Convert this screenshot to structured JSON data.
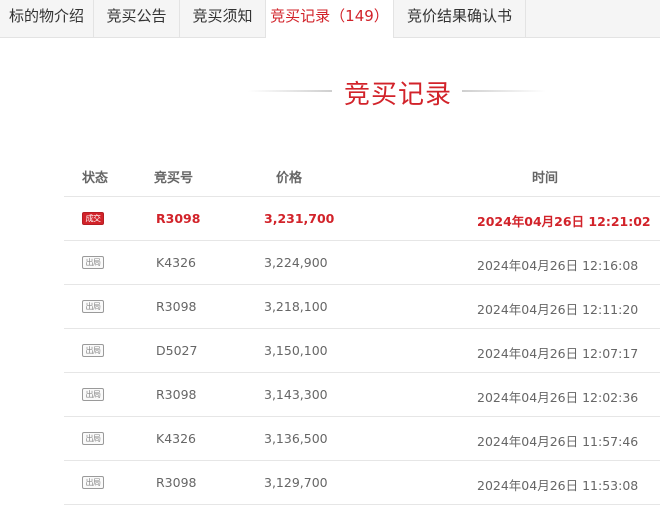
{
  "tabs": [
    {
      "label": "标的物介绍"
    },
    {
      "label": "竞买公告"
    },
    {
      "label": "竞买须知"
    },
    {
      "label": "竞买记录（149）"
    },
    {
      "label": "竞价结果确认书"
    }
  ],
  "section": {
    "title": "竞买记录"
  },
  "table": {
    "headers": {
      "status": "状态",
      "bid_no": "竞买号",
      "price": "价格",
      "time": "时间"
    },
    "rows": [
      {
        "status": "成交",
        "bid_no": "R3098",
        "price": "3,231,700",
        "time": "2024年04月26日 12:21:02"
      },
      {
        "status": "出局",
        "bid_no": "K4326",
        "price": "3,224,900",
        "time": "2024年04月26日 12:16:08"
      },
      {
        "status": "出局",
        "bid_no": "R3098",
        "price": "3,218,100",
        "time": "2024年04月26日 12:11:20"
      },
      {
        "status": "出局",
        "bid_no": "D5027",
        "price": "3,150,100",
        "time": "2024年04月26日 12:07:17"
      },
      {
        "status": "出局",
        "bid_no": "R3098",
        "price": "3,143,300",
        "time": "2024年04月26日 12:02:36"
      },
      {
        "status": "出局",
        "bid_no": "K4326",
        "price": "3,136,500",
        "time": "2024年04月26日 11:57:46"
      },
      {
        "status": "出局",
        "bid_no": "R3098",
        "price": "3,129,700",
        "time": "2024年04月26日 11:53:08"
      }
    ]
  },
  "colors": {
    "accent": "#d2232a"
  }
}
